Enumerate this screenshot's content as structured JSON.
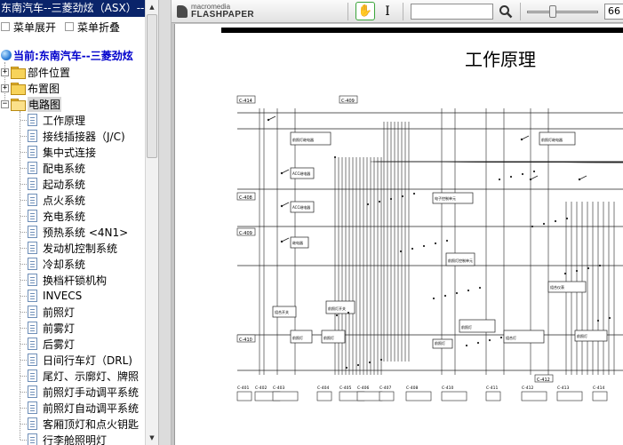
{
  "panel": {
    "title": "东南汽车--三菱劲炫（ASX）--",
    "expand_all": "菜单展开",
    "collapse_all": "菜单折叠",
    "current": "当前:东南汽车--三菱劲炫"
  },
  "tree": {
    "folders": [
      {
        "label": "部件位置",
        "toggle": "+"
      },
      {
        "label": "布置图",
        "toggle": "+"
      },
      {
        "label": "电路图",
        "toggle": "−"
      }
    ],
    "items": [
      "工作原理",
      "接线插接器（J/C)",
      "集中式连接",
      "配电系统",
      "起动系统",
      "点火系统",
      "充电系统",
      "预热系统 <4N1>",
      "发动机控制系统",
      "冷却系统",
      "换档杆锁机构",
      "INVECS",
      "前照灯",
      "前雾灯",
      "后雾灯",
      "日间行车灯（DRL)",
      "尾灯、示廓灯、牌照",
      "前照灯手动调平系统",
      "前照灯自动调平系统",
      "客厢顶灯和点火钥匙",
      "行李舱照明灯"
    ]
  },
  "toolbar": {
    "logo_line1": "macromedia",
    "logo_line2": "FLASHPAPER",
    "hand_icon": "✋",
    "text_icon": "I",
    "zoom": "66",
    "zoom_fraction": 0.35
  },
  "document": {
    "heading": "工作原理",
    "connector_labels": [
      "C-414",
      "C-409",
      "C-408",
      "C-409",
      "C-410",
      "C-412",
      "C-401",
      "C-402",
      "C-403",
      "C-404",
      "C-405",
      "C-406",
      "C-407",
      "C-408",
      "C-410",
      "C-411",
      "C-412",
      "C-413",
      "C-414"
    ],
    "box_labels": [
      "前照灯继电器",
      "前照灯继电器",
      "电子控制单元",
      "ACC继电器",
      "ACC继电器",
      "继电器",
      "前照灯控制单元",
      "组合仪表",
      "组合开关",
      "前照灯开关",
      "前照灯",
      "组合灯",
      "前照灯",
      "前照灯",
      "前照灯",
      "前照灯"
    ]
  }
}
